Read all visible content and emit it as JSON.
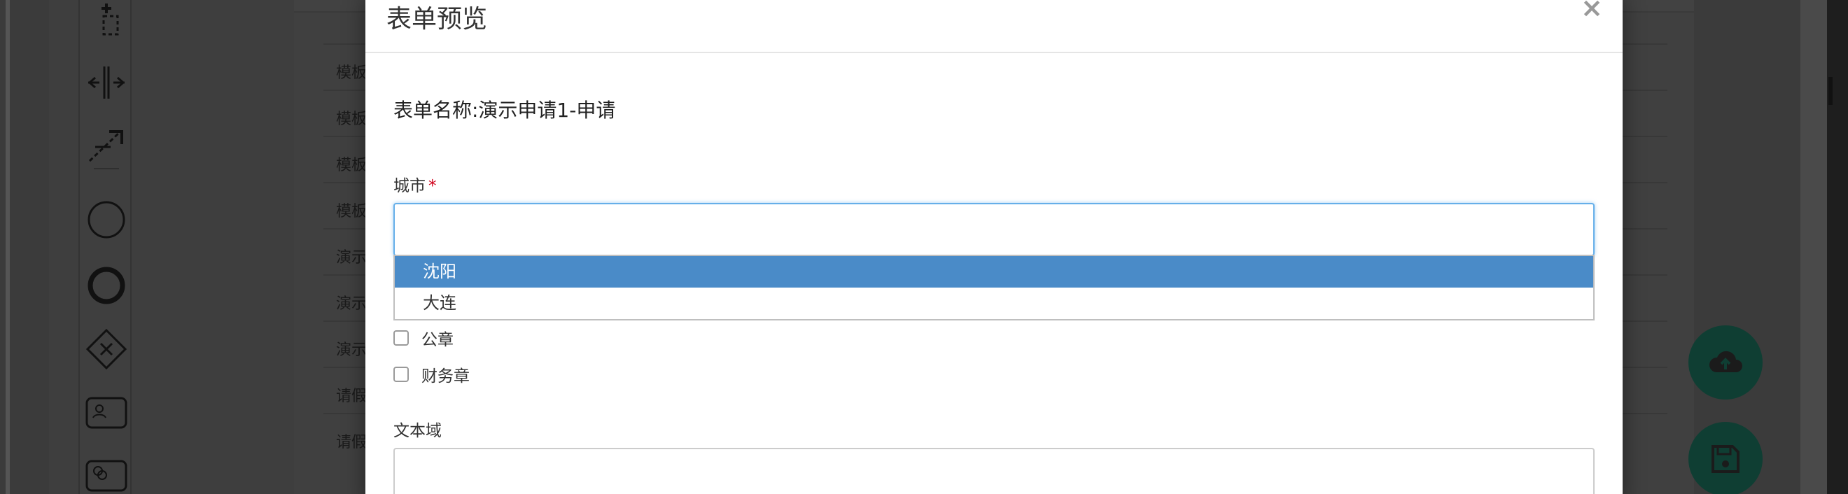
{
  "modal": {
    "title": "表单预览",
    "close": "×"
  },
  "form": {
    "name": "表单名称:演示申请1-申请",
    "city_label": "城市",
    "required_mark": "*",
    "city_value": "",
    "city_options": [
      "沈阳",
      "大连"
    ],
    "city_highlighted": "沈阳",
    "checkboxes": [
      {
        "label": "公章",
        "checked": false
      },
      {
        "label": "财务章",
        "checked": false
      }
    ],
    "textarea_label": "文本域",
    "textarea_value": ""
  },
  "background_list": {
    "rows": [
      "模板",
      "模板",
      "模板",
      "模板",
      "演示",
      "演示",
      "演示",
      "请假",
      "请假"
    ]
  },
  "colors": {
    "highlight": "#4a8bc8",
    "required": "#d0021b",
    "focus_border": "#66afe9",
    "fab": "#0f3e33"
  },
  "icons": {
    "fab_upload": "cloud-upload-icon",
    "fab_save": "save-icon",
    "palette": [
      "select-icon",
      "space-icon",
      "connect-icon",
      "start-event-icon",
      "end-event-icon",
      "gateway-icon",
      "user-task-icon",
      "service-task-icon"
    ]
  }
}
